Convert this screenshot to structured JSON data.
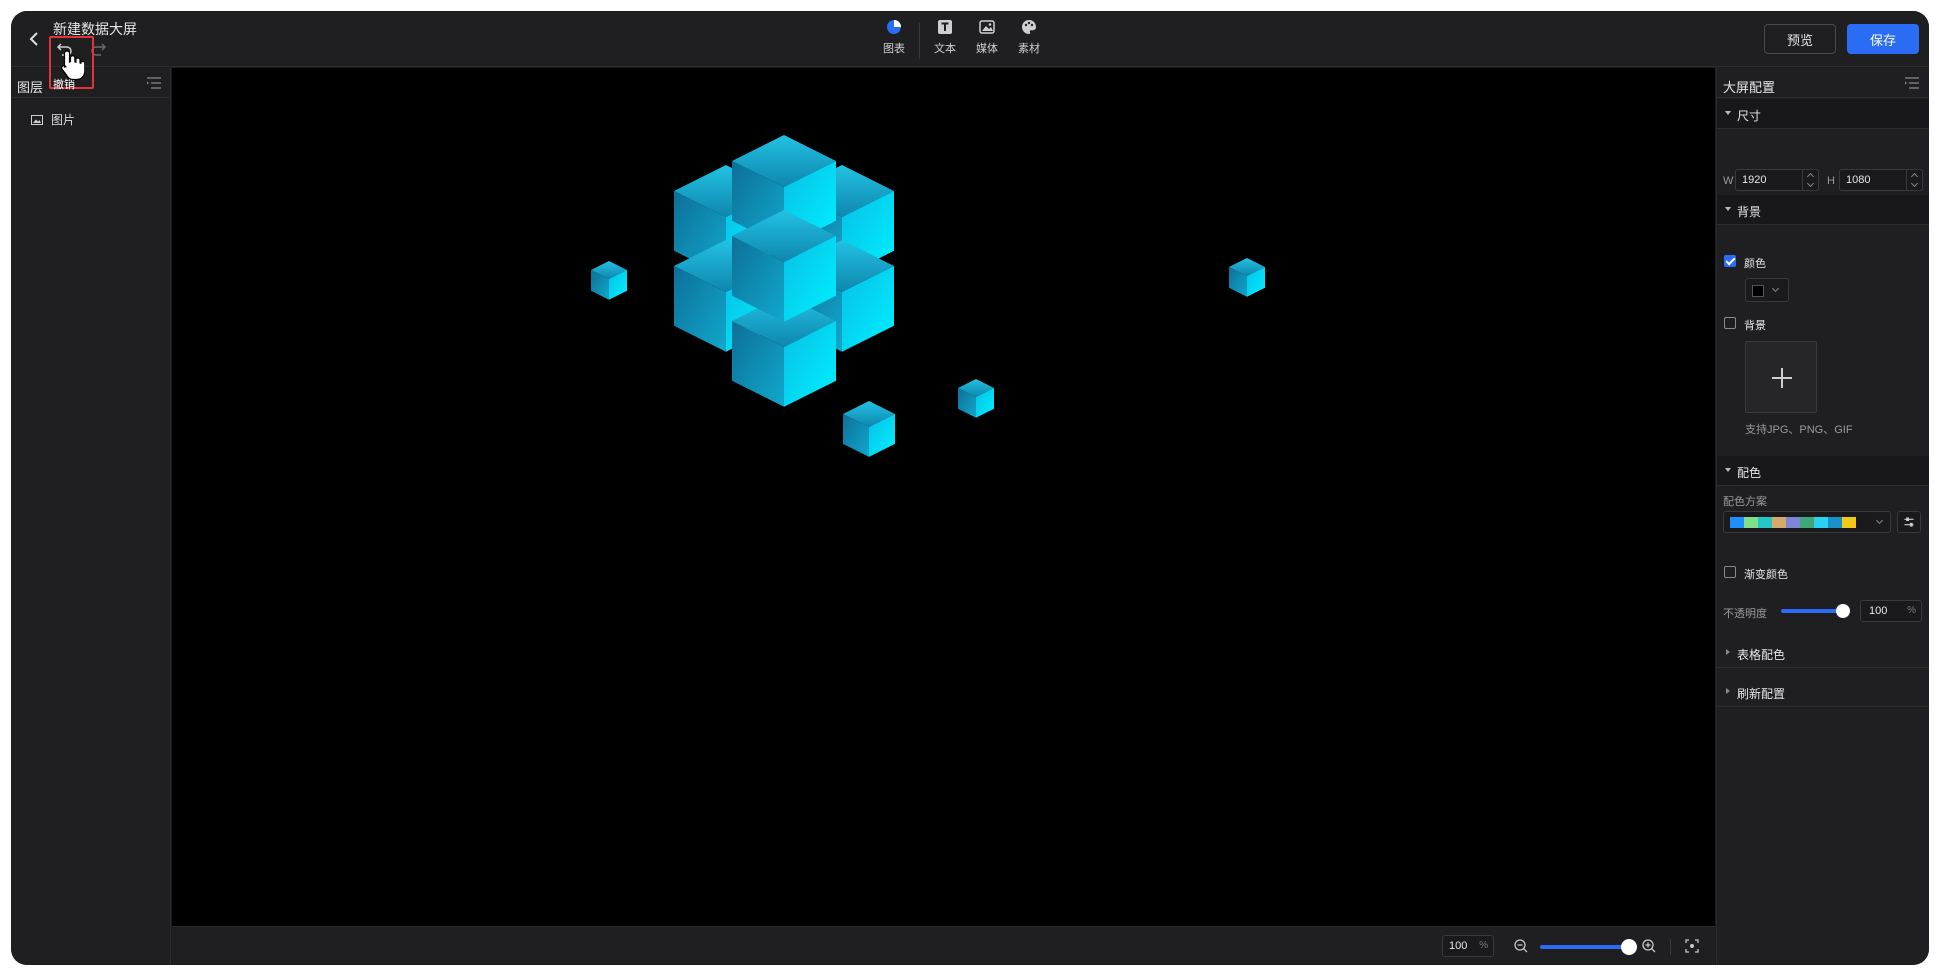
{
  "header": {
    "title": "新建数据大屏",
    "undo_tooltip": "撤销",
    "tools": [
      {
        "label": "图表",
        "icon": "pie-chart-icon"
      },
      {
        "label": "文本",
        "icon": "text-icon"
      },
      {
        "label": "媒体",
        "icon": "image-icon"
      },
      {
        "label": "素材",
        "icon": "palette-icon"
      }
    ],
    "preview_label": "预览",
    "save_label": "保存"
  },
  "layers": {
    "title": "图层",
    "items": [
      {
        "label": "图片",
        "icon": "image-icon"
      }
    ]
  },
  "config": {
    "title": "大屏配置",
    "size": {
      "section_label": "尺寸",
      "width_label": "W",
      "width_value": "1920",
      "height_label": "H",
      "height_value": "1080"
    },
    "background": {
      "section_label": "背景",
      "color_checkbox_label": "颜色",
      "color_checked": true,
      "color_value": "#000000",
      "image_checkbox_label": "背景",
      "image_checked": false,
      "upload_hint": "支持JPG、PNG、GIF"
    },
    "palette": {
      "section_label": "配色",
      "scheme_label": "配色方案",
      "scheme_colors": [
        "#1f8fff",
        "#7ee08a",
        "#26c6c6",
        "#d5a96a",
        "#7b86d6",
        "#3fa67a",
        "#2ad2f0",
        "#1a90c8",
        "#f4c81b"
      ],
      "gradient_label": "渐变颜色",
      "gradient_checked": false,
      "opacity_label": "不透明度",
      "opacity_value": "100",
      "opacity_unit": "%"
    },
    "table_palette_label": "表格配色",
    "refresh_label": "刷新配置"
  },
  "canvas": {
    "zoom_value": "100",
    "zoom_unit": "%",
    "zoom_level": 1.0
  },
  "colors": {
    "accent": "#2a6df4",
    "highlight": "#e0343a",
    "cube_light": "#00e5ff",
    "cube_dark": "#0a6f9a"
  }
}
